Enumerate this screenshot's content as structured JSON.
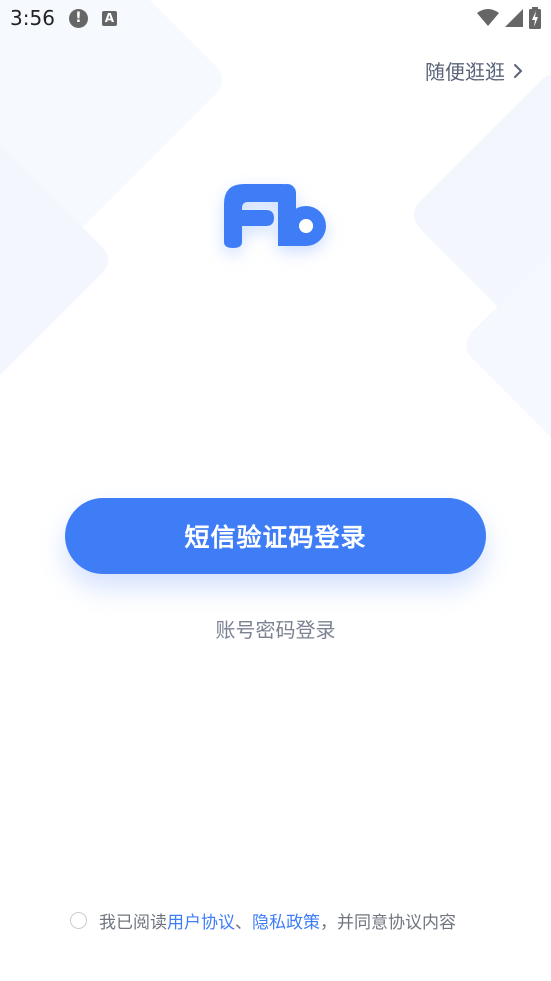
{
  "status_bar": {
    "time": "3:56",
    "alert_glyph": "!",
    "app_glyph": "A"
  },
  "header": {
    "browse_label": "随便逛逛"
  },
  "actions": {
    "sms_login_label": "短信验证码登录",
    "password_login_label": "账号密码登录"
  },
  "agreement": {
    "prefix": "我已阅读",
    "user_agreement": "用户协议",
    "separator": "、",
    "privacy_policy": "隐私政策",
    "suffix": "，并同意协议内容",
    "checked": false
  },
  "colors": {
    "accent": "#3f7df7",
    "text_secondary": "#7b8292"
  },
  "icons": [
    "alert-icon",
    "app-notification-icon",
    "wifi-icon",
    "signal-icon",
    "battery-charging-icon",
    "chevron-right-icon",
    "fb-logo-icon"
  ]
}
